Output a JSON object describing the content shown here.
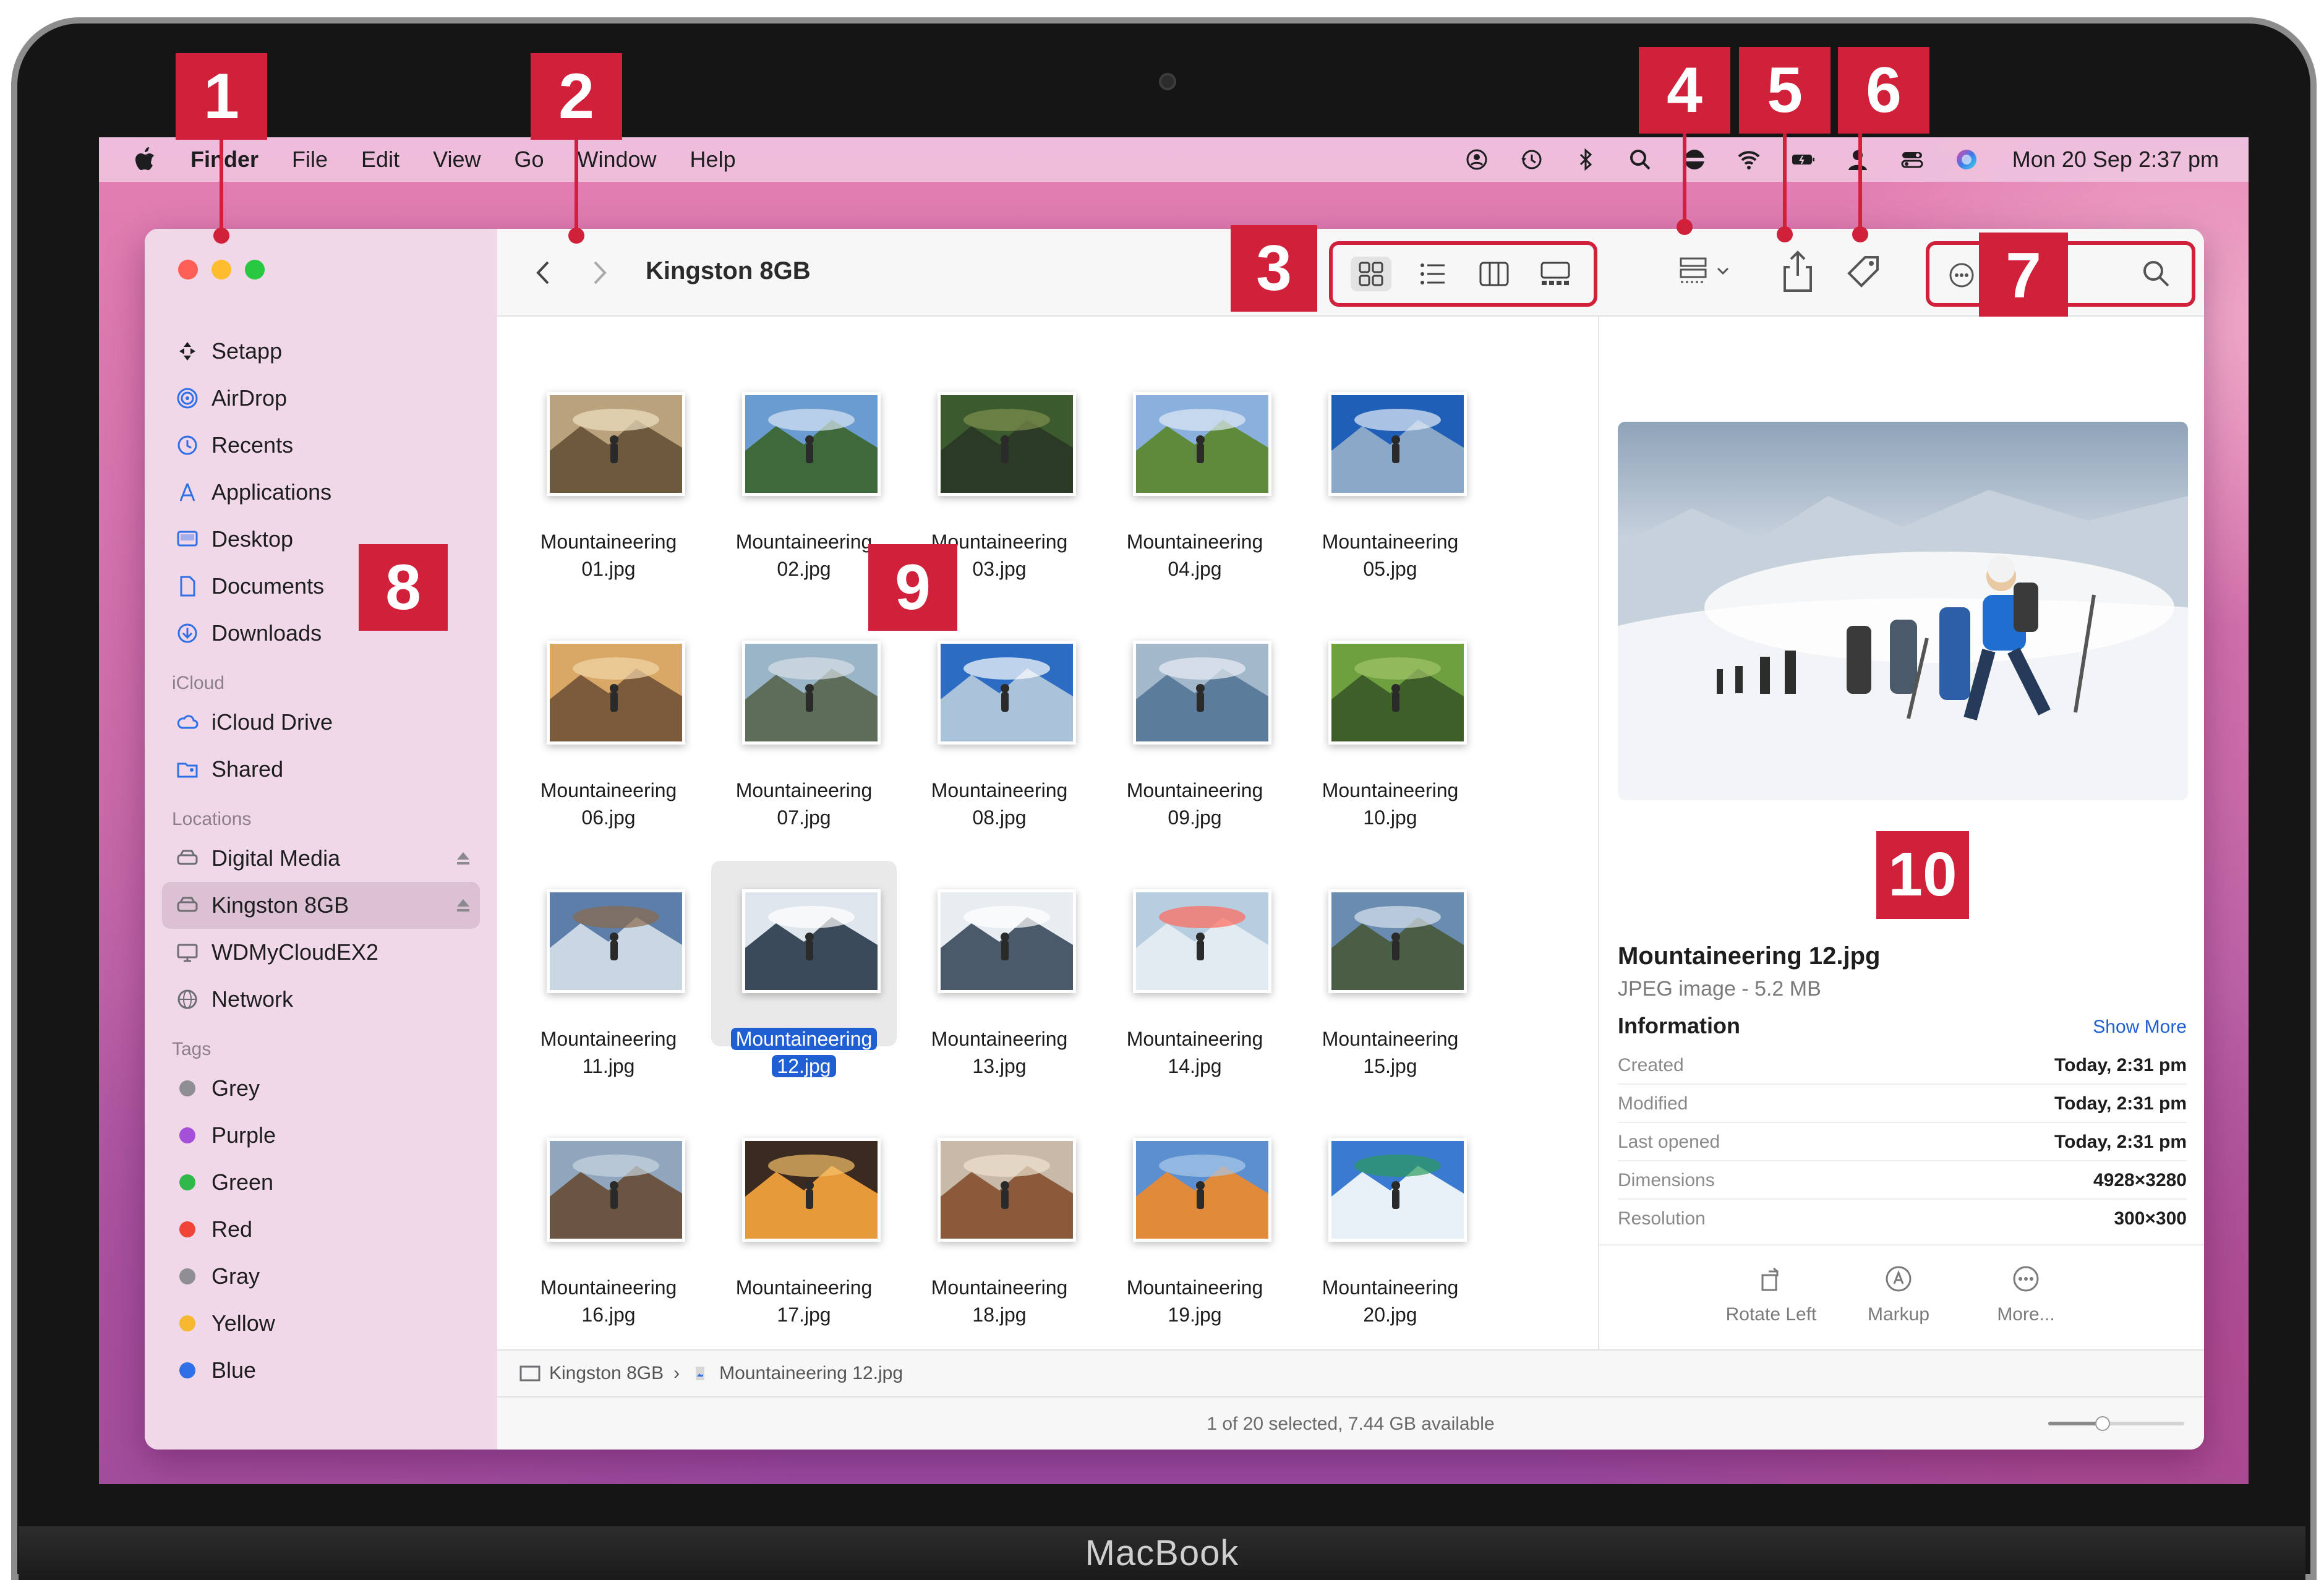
{
  "device": {
    "label": "MacBook"
  },
  "menubar": {
    "app_name": "Finder",
    "items": [
      "File",
      "Edit",
      "View",
      "Go",
      "Window",
      "Help"
    ],
    "clock": "Mon 20 Sep  2:37 pm"
  },
  "window": {
    "title": "Kingston 8GB"
  },
  "sidebar": {
    "favorites": [
      {
        "label": "Setapp",
        "icon": "setapp-icon"
      },
      {
        "label": "AirDrop",
        "icon": "airdrop-icon"
      },
      {
        "label": "Recents",
        "icon": "clock-icon"
      },
      {
        "label": "Applications",
        "icon": "applications-icon"
      },
      {
        "label": "Desktop",
        "icon": "desktop-icon"
      },
      {
        "label": "Documents",
        "icon": "document-icon"
      },
      {
        "label": "Downloads",
        "icon": "download-icon"
      }
    ],
    "icloud_header": "iCloud",
    "icloud": [
      {
        "label": "iCloud Drive",
        "icon": "cloud-icon"
      },
      {
        "label": "Shared",
        "icon": "shared-folder-icon"
      }
    ],
    "locations_header": "Locations",
    "locations": [
      {
        "label": "Digital Media",
        "icon": "drive-icon",
        "eject": true
      },
      {
        "label": "Kingston 8GB",
        "icon": "drive-icon",
        "eject": true,
        "selected": true
      },
      {
        "label": "WDMyCloudEX2",
        "icon": "monitor-icon",
        "eject": false
      },
      {
        "label": "Network",
        "icon": "globe-icon",
        "eject": false
      }
    ],
    "tags_header": "Tags",
    "tags": [
      {
        "label": "Grey",
        "color": "#8e8e93"
      },
      {
        "label": "Purple",
        "color": "#a550d8"
      },
      {
        "label": "Green",
        "color": "#30b94a"
      },
      {
        "label": "Red",
        "color": "#f0433a"
      },
      {
        "label": "Gray",
        "color": "#8e8e93"
      },
      {
        "label": "Yellow",
        "color": "#f5b82e"
      },
      {
        "label": "Blue",
        "color": "#2f6fe8"
      }
    ]
  },
  "files": [
    {
      "line1": "Mountaineering",
      "line2": "01.jpg"
    },
    {
      "line1": "Mountaineering",
      "line2": "02.jpg"
    },
    {
      "line1": "Mountaineering",
      "line2": "03.jpg"
    },
    {
      "line1": "Mountaineering",
      "line2": "04.jpg"
    },
    {
      "line1": "Mountaineering",
      "line2": "05.jpg"
    },
    {
      "line1": "Mountaineering",
      "line2": "06.jpg"
    },
    {
      "line1": "Mountaineering",
      "line2": "07.jpg"
    },
    {
      "line1": "Mountaineering",
      "line2": "08.jpg"
    },
    {
      "line1": "Mountaineering",
      "line2": "09.jpg"
    },
    {
      "line1": "Mountaineering",
      "line2": "10.jpg"
    },
    {
      "line1": "Mountaineering",
      "line2": "11.jpg"
    },
    {
      "line1": "Mountaineering",
      "line2": "12.jpg",
      "selected": true
    },
    {
      "line1": "Mountaineering",
      "line2": "13.jpg"
    },
    {
      "line1": "Mountaineering",
      "line2": "14.jpg"
    },
    {
      "line1": "Mountaineering",
      "line2": "15.jpg"
    },
    {
      "line1": "Mountaineering",
      "line2": "16.jpg"
    },
    {
      "line1": "Mountaineering",
      "line2": "17.jpg"
    },
    {
      "line1": "Mountaineering",
      "line2": "18.jpg"
    },
    {
      "line1": "Mountaineering",
      "line2": "19.jpg"
    },
    {
      "line1": "Mountaineering",
      "line2": "20.jpg"
    }
  ],
  "preview": {
    "name": "Mountaineering 12.jpg",
    "type": "JPEG image - 5.2 MB",
    "info_header": "Information",
    "show_more": "Show More",
    "info": [
      {
        "key": "Created",
        "value": "Today, 2:31 pm"
      },
      {
        "key": "Modified",
        "value": "Today, 2:31 pm"
      },
      {
        "key": "Last opened",
        "value": "Today, 2:31 pm"
      },
      {
        "key": "Dimensions",
        "value": "4928×3280"
      },
      {
        "key": "Resolution",
        "value": "300×300"
      }
    ],
    "actions": [
      "Rotate Left",
      "Markup",
      "More..."
    ]
  },
  "pathbar": {
    "volume": "Kingston 8GB",
    "file": "Mountaineering 12.jpg"
  },
  "statusbar": {
    "text": "1 of 20 selected, 7.44 GB available",
    "zoom_level": 0.4
  },
  "search": {
    "value": "",
    "placeholder": ""
  },
  "callouts": [
    "1",
    "2",
    "3",
    "4",
    "5",
    "6",
    "7",
    "8",
    "9",
    "10"
  ],
  "colors": {
    "callout_red": "#d1203a",
    "selection_blue": "#1f5fd1"
  }
}
